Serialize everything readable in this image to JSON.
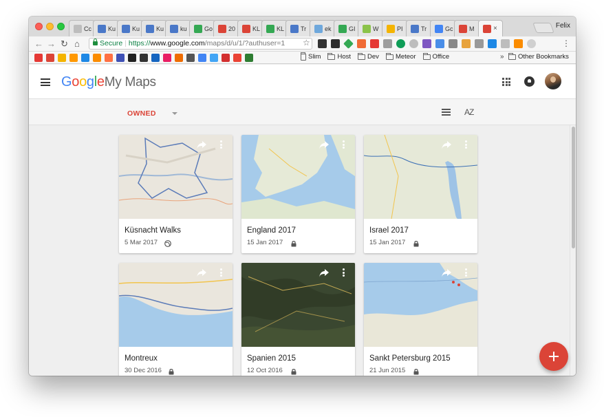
{
  "browser": {
    "tabs": [
      {
        "title": "Cc",
        "color": "#bdbdbd"
      },
      {
        "title": "Ku",
        "color": "#4a78c8"
      },
      {
        "title": "Ku",
        "color": "#4a78c8"
      },
      {
        "title": "Ku",
        "color": "#4a78c8"
      },
      {
        "title": "ku",
        "color": "#4a78c8"
      },
      {
        "title": "Go",
        "color": "#34a853"
      },
      {
        "title": "20",
        "color": "#db4437"
      },
      {
        "title": "KL",
        "color": "#db4437"
      },
      {
        "title": "KL",
        "color": "#34a853"
      },
      {
        "title": "Tr",
        "color": "#4a78c8"
      },
      {
        "title": "ek",
        "color": "#6fa8dc"
      },
      {
        "title": "GI",
        "color": "#34a853"
      },
      {
        "title": "W",
        "color": "#8bc34a"
      },
      {
        "title": "PI",
        "color": "#f4b400"
      },
      {
        "title": "Tr",
        "color": "#4a78c8"
      },
      {
        "title": "Gc",
        "color": "#4285f4"
      },
      {
        "title": "M",
        "color": "#db4437"
      }
    ],
    "active_tab": {
      "title": "",
      "color": "#db4437"
    },
    "profile_name": "Felix",
    "address": {
      "secure_label": "Secure",
      "scheme": "https://",
      "host": "www.google.com",
      "path": "/maps/d/u/1/?authuser=1"
    },
    "bookmarks": [
      {
        "label": "Slim",
        "type": "page"
      },
      {
        "label": "Host",
        "type": "folder"
      },
      {
        "label": "Dev",
        "type": "folder"
      },
      {
        "label": "Meteor",
        "type": "folder"
      },
      {
        "label": "Office",
        "type": "folder"
      }
    ],
    "other_bookmarks": "Other Bookmarks",
    "overflow": "»"
  },
  "app": {
    "logo_google": "Google",
    "logo_product": "My Maps",
    "filter_label": "OWNED",
    "sort_label": "AZ"
  },
  "maps": [
    {
      "title": "Küsnacht Walks",
      "date": "5 Mar 2017",
      "visibility": "public",
      "map_style": "light"
    },
    {
      "title": "England 2017",
      "date": "15 Jan 2017",
      "visibility": "private",
      "map_style": "sea"
    },
    {
      "title": "Israel 2017",
      "date": "15 Jan 2017",
      "visibility": "private",
      "map_style": "land"
    },
    {
      "title": "Montreux",
      "date": "30 Dec 2016",
      "visibility": "private",
      "map_style": "lake"
    },
    {
      "title": "Spanien 2015",
      "date": "12 Oct 2016",
      "visibility": "private",
      "map_style": "satellite"
    },
    {
      "title": "Sankt Petersburg 2015",
      "date": "21 Jun 2015",
      "visibility": "private",
      "map_style": "coast"
    }
  ],
  "colors": {
    "accent": "#db4437",
    "google_blue": "#4285f4",
    "google_red": "#ea4335",
    "google_yellow": "#fbbc05",
    "google_green": "#34a853"
  }
}
